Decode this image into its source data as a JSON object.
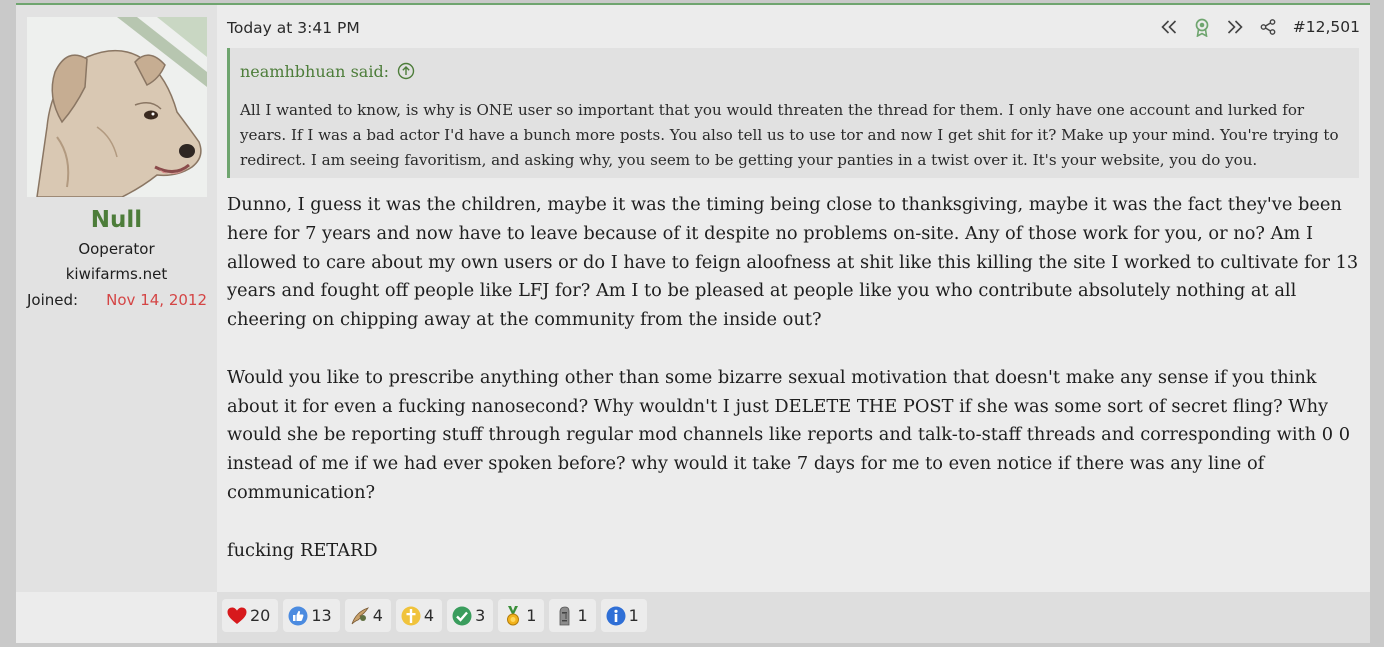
{
  "post": {
    "timestamp": "Today at 3:41 PM",
    "number": "#12,501",
    "tools": [
      "rewind-icon",
      "award-icon",
      "fast-forward-icon",
      "share-icon"
    ]
  },
  "user": {
    "name": "Null",
    "title": "Ooperator",
    "site": "kiwifarms.net",
    "joined_label": "Joined:",
    "joined_date": "Nov 14, 2012"
  },
  "quote": {
    "attribution": "neamhbhuan said:",
    "body": "All I wanted to know, is why is ONE user so important that you would threaten the thread for them. I only have one account and lurked for years. If I was a bad actor I'd have a bunch more posts. You also tell us to use tor and now I get shit for it? Make up your mind. You're trying to redirect. I am seeing favoritism, and asking why, you seem to be getting your panties in a twist over it. It's your website, you do you."
  },
  "message": {
    "paragraphs": [
      "Dunno, I guess it was the children, maybe it was the timing being close to thanksgiving, maybe it was the fact they've been here for 7 years and now have to leave because of it despite no problems on-site. Any of those work for you, or no? Am I allowed to care about my own users or do I have to feign aloofness at shit like this killing the site I worked to cultivate for 13 years and fought off people like LFJ for? Am I to be pleased at people like you who contribute absolutely nothing at all cheering on chipping away at the community from the inside out?",
      "Would you like to prescribe anything other than some bizarre sexual motivation that doesn't make any sense if you think about it for even a fucking nanosecond? Why wouldn't I just DELETE THE POST if she was some sort of secret fling? Why would she be reporting stuff through regular mod channels like reports and talk-to-staff threads and corresponding with 0 0 instead of me if we had ever spoken before? why would it take 7 days for me to even notice if there was any line of communication?",
      "fucking RETARD"
    ]
  },
  "reactions": [
    {
      "icon": "heart-icon",
      "count": "20"
    },
    {
      "icon": "thumbs-up-icon",
      "count": "13"
    },
    {
      "icon": "feather-icon",
      "count": "4"
    },
    {
      "icon": "cross-icon",
      "count": "4"
    },
    {
      "icon": "check-icon",
      "count": "3"
    },
    {
      "icon": "medal-icon",
      "count": "1"
    },
    {
      "icon": "moai-icon",
      "count": "1"
    },
    {
      "icon": "info-icon",
      "count": "1"
    }
  ],
  "colors": {
    "accent_green": "#4d7d3a",
    "joined_red": "#d44545",
    "quote_border": "#6fa56f"
  }
}
